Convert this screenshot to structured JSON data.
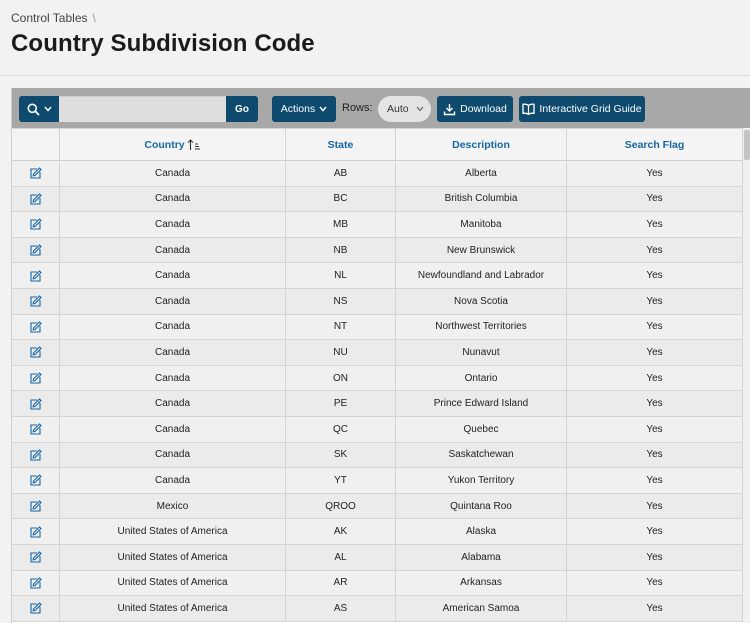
{
  "breadcrumb": {
    "parent": "Control Tables",
    "separator": "\\"
  },
  "page_title": "Country Subdivision Code",
  "toolbar": {
    "search_value": "",
    "go_label": "Go",
    "actions_label": "Actions",
    "rows_label": "Rows:",
    "rows_value": "Auto",
    "download_label": "Download",
    "guide_label": "Interactive Grid Guide"
  },
  "columns": {
    "country": "Country",
    "state": "State",
    "description": "Description",
    "search_flag": "Search Flag"
  },
  "rows": [
    {
      "country": "Canada",
      "state": "AB",
      "description": "Alberta",
      "flag": "Yes"
    },
    {
      "country": "Canada",
      "state": "BC",
      "description": "British Columbia",
      "flag": "Yes"
    },
    {
      "country": "Canada",
      "state": "MB",
      "description": "Manitoba",
      "flag": "Yes"
    },
    {
      "country": "Canada",
      "state": "NB",
      "description": "New Brunswick",
      "flag": "Yes"
    },
    {
      "country": "Canada",
      "state": "NL",
      "description": "Newfoundland and Labrador",
      "flag": "Yes"
    },
    {
      "country": "Canada",
      "state": "NS",
      "description": "Nova Scotia",
      "flag": "Yes"
    },
    {
      "country": "Canada",
      "state": "NT",
      "description": "Northwest Territories",
      "flag": "Yes"
    },
    {
      "country": "Canada",
      "state": "NU",
      "description": "Nunavut",
      "flag": "Yes"
    },
    {
      "country": "Canada",
      "state": "ON",
      "description": "Ontario",
      "flag": "Yes"
    },
    {
      "country": "Canada",
      "state": "PE",
      "description": "Prince Edward Island",
      "flag": "Yes"
    },
    {
      "country": "Canada",
      "state": "QC",
      "description": "Quebec",
      "flag": "Yes"
    },
    {
      "country": "Canada",
      "state": "SK",
      "description": "Saskatchewan",
      "flag": "Yes"
    },
    {
      "country": "Canada",
      "state": "YT",
      "description": "Yukon Territory",
      "flag": "Yes"
    },
    {
      "country": "Mexico",
      "state": "QROO",
      "description": "Quintana Roo",
      "flag": "Yes"
    },
    {
      "country": "United States of America",
      "state": "AK",
      "description": "Alaska",
      "flag": "Yes"
    },
    {
      "country": "United States of America",
      "state": "AL",
      "description": "Alabama",
      "flag": "Yes"
    },
    {
      "country": "United States of America",
      "state": "AR",
      "description": "Arkansas",
      "flag": "Yes"
    },
    {
      "country": "United States of America",
      "state": "AS",
      "description": "American Samoa",
      "flag": "Yes"
    }
  ],
  "colors": {
    "accent": "#0d4a6e",
    "link": "#1566a8",
    "toolbar_bg": "#a8a8a8"
  }
}
